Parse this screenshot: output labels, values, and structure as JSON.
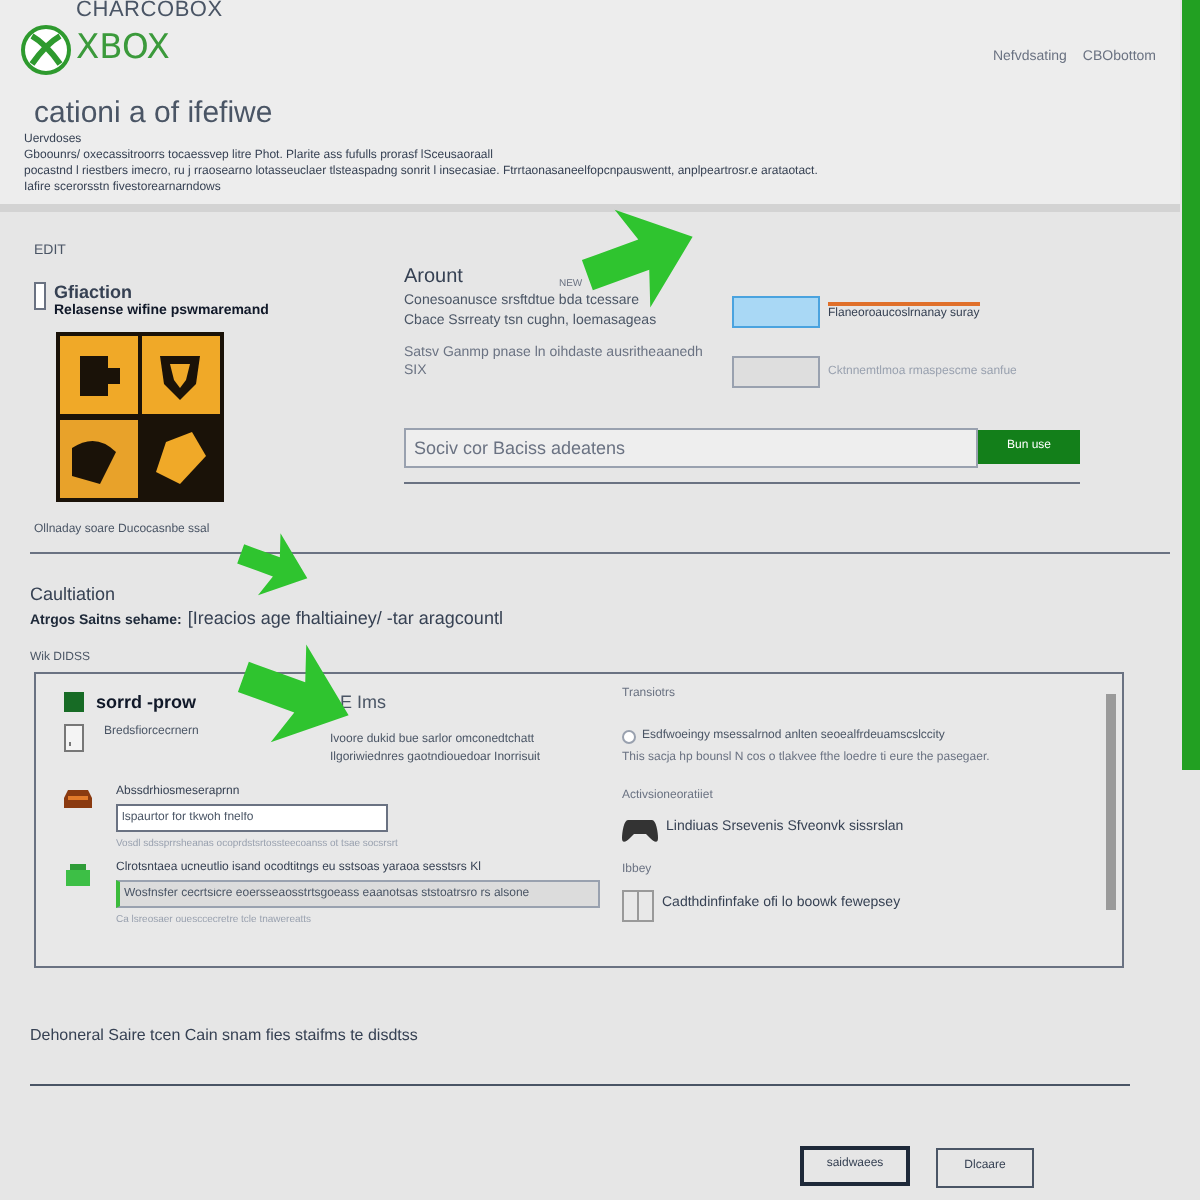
{
  "header": {
    "brand_cut": "CHARCOBOX",
    "brand": "XBOX",
    "links": [
      "Nefvdsating",
      "CBObottom"
    ]
  },
  "intro": {
    "title": "cationi a of ifefiwe",
    "lines": [
      "Uervdoses",
      "Gboounrs/ oxecassitroorrs tocaessvep litre Phot. Plarite ass fufulls prorasf lSceusaoraall",
      "pocastnd l riestbers imecro, ru j rraosearno lotasseuclaer tlsteaspadng sonrit l insecasiae. Ftrrtaonasaneelfopcnpauswentt, anplpeartrosr.e arataotact.",
      "Iafire scerorsstn fivestorearnarndows"
    ]
  },
  "edit": {
    "label": "EDIT",
    "product": {
      "checked": false,
      "title": "Gfiaction",
      "subtitle": "Relasense wifine pswmaremand",
      "caption": "Ollnaday soare Ducocasnbe ssal"
    },
    "account": {
      "title": "Arount",
      "tag": "NEW",
      "lines": [
        "Conesoanusce srsftdtue bda tcessare",
        "Cbace Ssrreaty tsn cughn, loemasageas"
      ],
      "note": "Satsv Ganmp pnase ln oihdaste ausritheaanedh SIX",
      "options": [
        {
          "label": "Flaneoroaucoslrnanay suray",
          "selected": true
        },
        {
          "label": "Cktnnemtlmoa rmaspescme sanfue",
          "selected": false
        }
      ]
    },
    "search": {
      "placeholder": "Sociv cor Baciss adeatens",
      "button": "Bun use"
    }
  },
  "caution": {
    "title": "Caultiation",
    "label": "Atrgos Saitns sehame:",
    "value": "[Ireacios age fhaltiainey/  -tar aragcountl",
    "list_label": "Wik DIDSS"
  },
  "panel": {
    "heading": "sorrd -prow",
    "subheading": "E Ims",
    "left": [
      {
        "kind": "text",
        "label": "Bredsfiorcecrnern",
        "lines": [
          "Ivoore dukid bue sarlor omconedtchatt",
          "Ilgoriwiednres gaotndiouedoar Inorrisuit"
        ]
      },
      {
        "kind": "field",
        "label": "Abssdrhiosmeseraprnn",
        "value": "lspaurtor for tkwoh fnelfo",
        "hint": "Vosdl sdssprrsheanas ocoprdstsrtossteecoanss ot tsae socsrsrt"
      },
      {
        "kind": "field",
        "label": "Clrotsntaea ucneutlio isand ocodtitngs eu sstsoas yaraoa sesstsrs Kl",
        "value": "Wosfnsfer cecrtsicre eoersseaosstrtsgoeass eaanotsas ststoatrsro rs alsone",
        "hint": "Ca lsreosaer ouesccecretre tcle tnawereatts"
      }
    ],
    "right": [
      {
        "kind": "radio",
        "heading": "Transiotrs",
        "label": "Esdfwoeingy msessalrnod anlten seoealfrdeuamscslccity",
        "desc": "This sacja hp bounsl N cos o tlakvee fthe loedre ti eure the pasegaer.",
        "selected": false
      },
      {
        "kind": "controller",
        "heading": "Activsioneoratiiet",
        "label": "Lindiuas Srsevenis Sfveonvk sissrslan"
      },
      {
        "kind": "book",
        "heading": "Ibbey",
        "label": "Cadthdinfinfake ofi lo boowk fewepsey"
      }
    ]
  },
  "footer": {
    "note": "Dehoneral Saire tcen Cain snam fies staifms te disdtss",
    "buttons": [
      {
        "label": "saidwaees",
        "default": true
      },
      {
        "label": "Dlcaare",
        "default": false
      }
    ]
  }
}
